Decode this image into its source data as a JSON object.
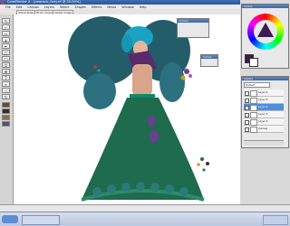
{
  "window": {
    "title": "CorelPainter X - [peacock_fairy.rif @ 25.00%]",
    "buttons": {
      "minimize": "_",
      "maximize": "□",
      "close": "x"
    }
  },
  "menu": [
    "File",
    "Edit",
    "Canvas",
    "Layers",
    "Select",
    "Shapes",
    "Effects",
    "Movie",
    "Window",
    "Help"
  ],
  "property_bar": [
    "Actual Pixels",
    "Fit On Screen",
    "Center Image"
  ],
  "toolbox": {
    "tools": [
      "brush-icon",
      "dropper-icon",
      "eraser-icon",
      "paint-bucket-icon",
      "pen-icon",
      "rectangle-icon",
      "lasso-icon",
      "crop-icon",
      "transform-icon",
      "text-icon",
      "magnifier-icon",
      "hand-icon",
      "rotate-icon"
    ]
  },
  "panels": {
    "colors_title": "Colors",
    "mixer_title": "Colors",
    "layers_title": "Layers",
    "layers_mode": "Default",
    "layers": [
      "Canvas",
      "Layer 2",
      "Layer 3",
      "Layer 4",
      "Layer 5",
      "Layer 6"
    ]
  },
  "colors": {
    "accent": "#3a66ad",
    "dress": "#1e6b4e",
    "wings": "#245d6a",
    "hair": "#1aa3c2",
    "top": "#5a2a6e"
  }
}
